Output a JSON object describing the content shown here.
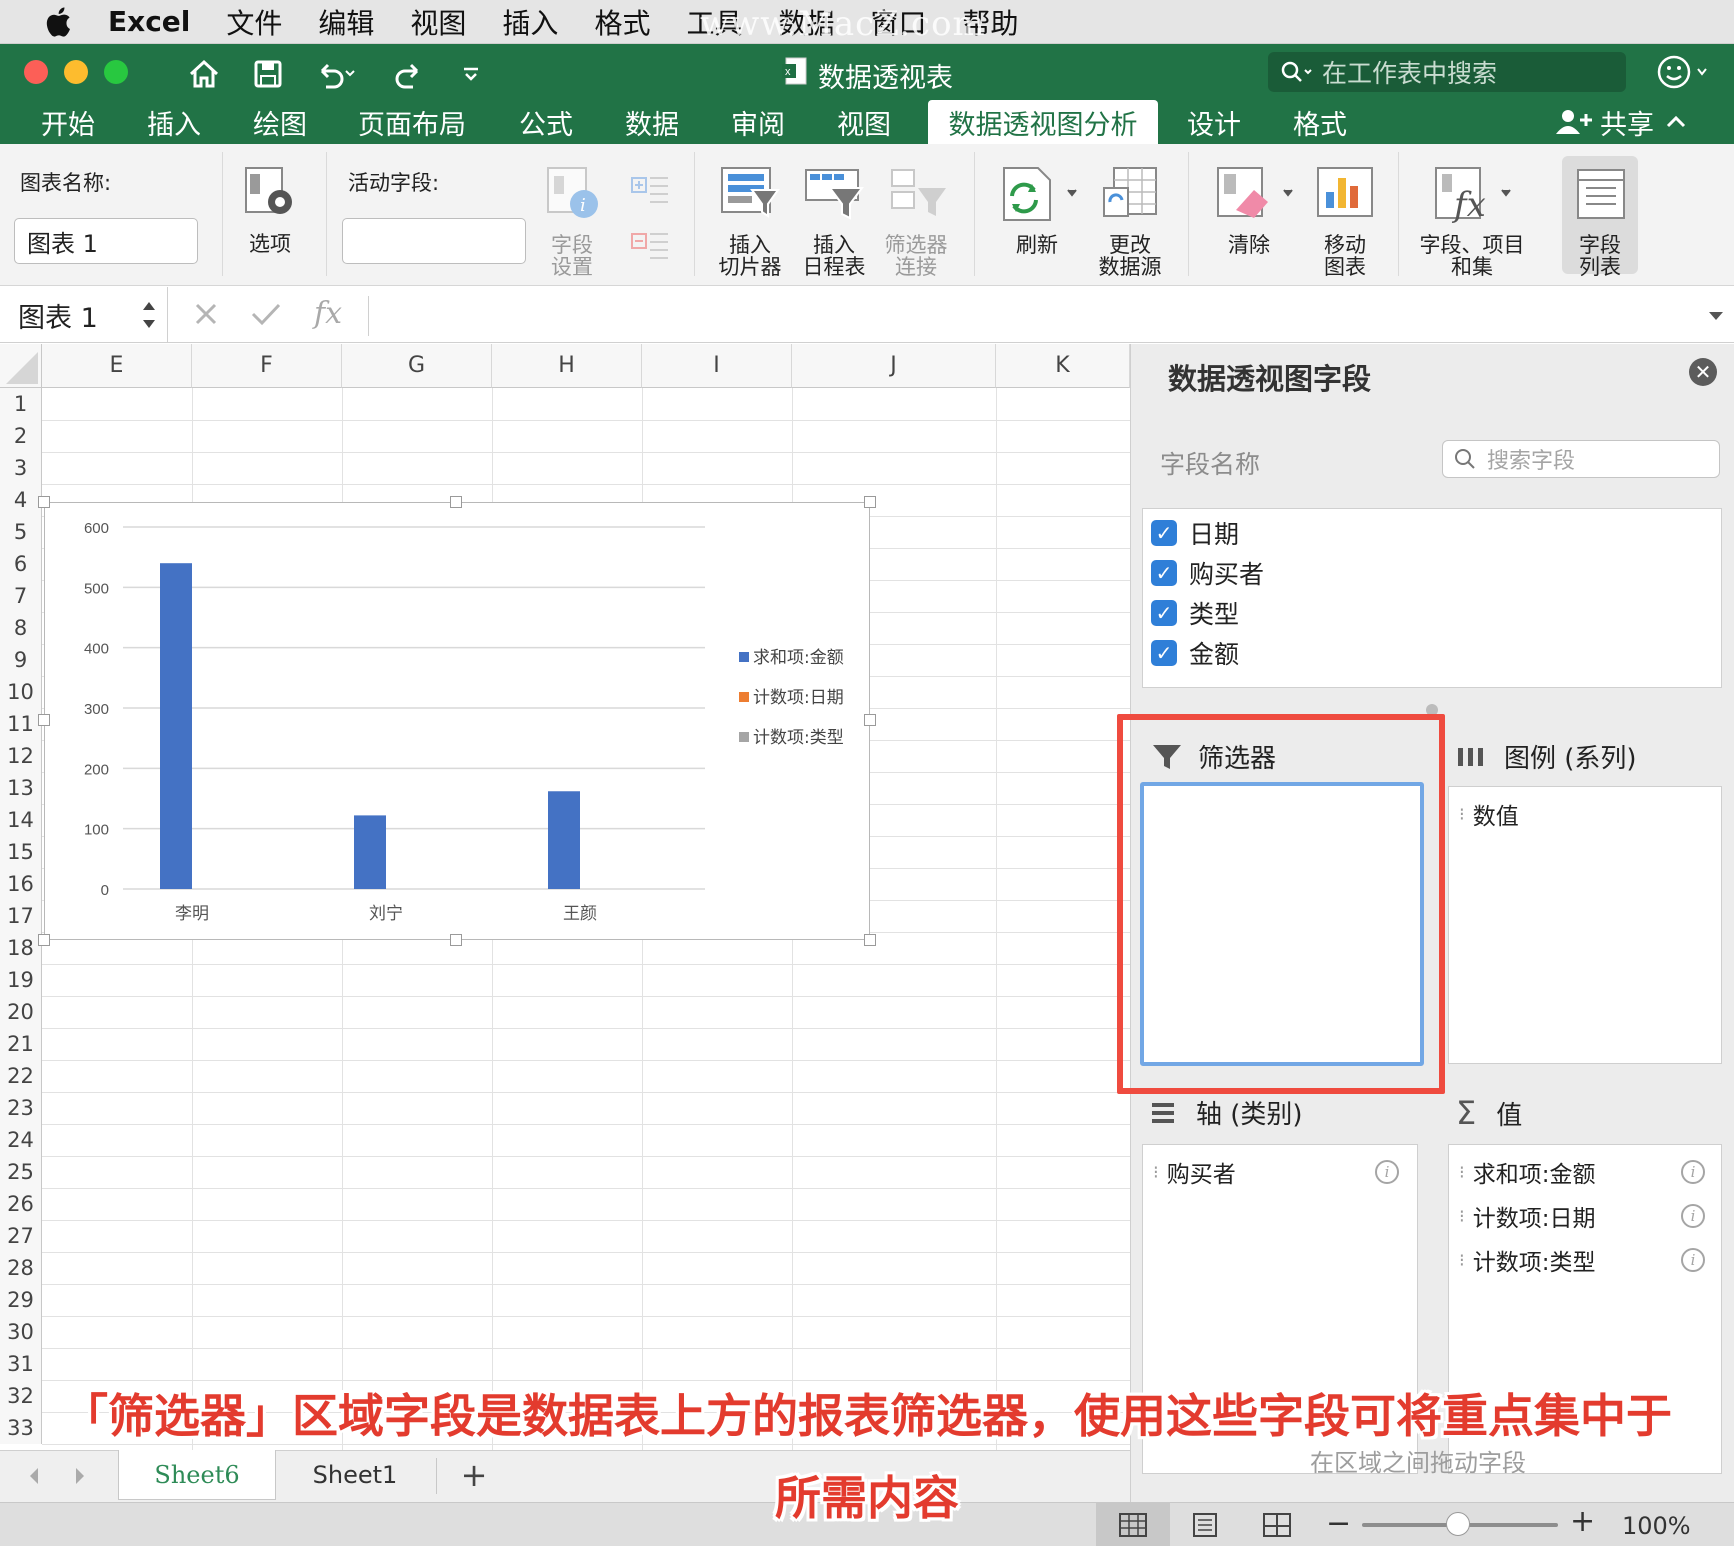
{
  "menubar": {
    "app_name": "Excel",
    "items": [
      "文件",
      "编辑",
      "视图",
      "插入",
      "格式",
      "工具",
      "数据",
      "窗口",
      "帮助"
    ],
    "watermark": "www.MacZ.com"
  },
  "window": {
    "title": "数据透视表",
    "search_placeholder": "在工作表中搜索",
    "share_label": "共享"
  },
  "tabs": {
    "items": [
      "开始",
      "插入",
      "绘图",
      "页面布局",
      "公式",
      "数据",
      "审阅",
      "视图",
      "数据透视图分析",
      "设计",
      "格式"
    ],
    "active": "数据透视图分析"
  },
  "ribbon": {
    "chart_name_label": "图表名称:",
    "chart_name_value": "图表 1",
    "options_label": "选项",
    "active_field_label": "活动字段:",
    "active_field_value": "",
    "field_settings_label_1": "字段",
    "field_settings_label_2": "设置",
    "insert_slicer_1": "插入",
    "insert_slicer_2": "切片器",
    "insert_timeline_1": "插入",
    "insert_timeline_2": "日程表",
    "filter_conn_1": "筛选器",
    "filter_conn_2": "连接",
    "refresh_label": "刷新",
    "change_source_1": "更改",
    "change_source_2": "数据源",
    "clear_label": "清除",
    "move_chart_1": "移动",
    "move_chart_2": "图表",
    "fields_items_1": "字段、项目",
    "fields_items_2": "和集",
    "field_list_1": "字段",
    "field_list_2": "列表"
  },
  "formula_bar": {
    "name_box": "图表 1",
    "fx": "fx",
    "content": ""
  },
  "grid": {
    "columns": [
      "E",
      "F",
      "G",
      "H",
      "I",
      "J",
      "K"
    ],
    "rows": [
      "1",
      "2",
      "3",
      "4",
      "5",
      "6",
      "7",
      "8",
      "9",
      "10",
      "11",
      "12",
      "13",
      "14",
      "15",
      "16",
      "17",
      "18",
      "19",
      "20",
      "21",
      "22",
      "23",
      "24",
      "25",
      "26",
      "27",
      "28",
      "29",
      "30",
      "31",
      "32",
      "33"
    ]
  },
  "chart_data": {
    "type": "bar",
    "categories": [
      "李明",
      "刘宁",
      "王颜"
    ],
    "series": [
      {
        "name": "求和项:金额",
        "values": [
          540,
          122,
          162
        ],
        "color": "#4472c4"
      },
      {
        "name": "计数项:日期",
        "values": [
          0,
          0,
          0
        ],
        "color": "#ed7d31"
      },
      {
        "name": "计数项:类型",
        "values": [
          0,
          0,
          0
        ],
        "color": "#a5a5a5"
      }
    ],
    "yticks": [
      "600",
      "500",
      "400",
      "300",
      "200",
      "100",
      "0"
    ],
    "ylim": [
      0,
      600
    ],
    "grid": true,
    "legend_position": "right"
  },
  "panel": {
    "title": "数据透视图字段",
    "close_icon": "close-icon",
    "field_name_label": "字段名称",
    "search_placeholder": "搜索字段",
    "fields": [
      {
        "label": "日期",
        "checked": true
      },
      {
        "label": "购买者",
        "checked": true
      },
      {
        "label": "类型",
        "checked": true
      },
      {
        "label": "金额",
        "checked": true
      }
    ],
    "filters_label": "筛选器",
    "legend_label": "图例 (系列)",
    "legend_items": [
      "数值"
    ],
    "axis_label": "轴 (类别)",
    "axis_items": [
      "购买者"
    ],
    "values_label": "值",
    "values_items": [
      "求和项:金额",
      "计数项:日期",
      "计数项:类型"
    ],
    "drag_tip": "在区域之间拖动字段"
  },
  "sheets": {
    "items": [
      "Sheet6",
      "Sheet1"
    ],
    "active": "Sheet6",
    "add_label": "+"
  },
  "status": {
    "zoom": "100%",
    "minus": "−",
    "plus": "+"
  },
  "caption": {
    "line1": "「筛选器」区域字段是数据表上方的报表筛选器，使用这些字段可将重点集中于",
    "line2": "所需内容"
  },
  "colors": {
    "excel_green": "#217346",
    "highlight_red": "#ef4b3f",
    "filter_box_blue": "#72a7e5",
    "checkbox_blue": "#2f7fd8"
  }
}
